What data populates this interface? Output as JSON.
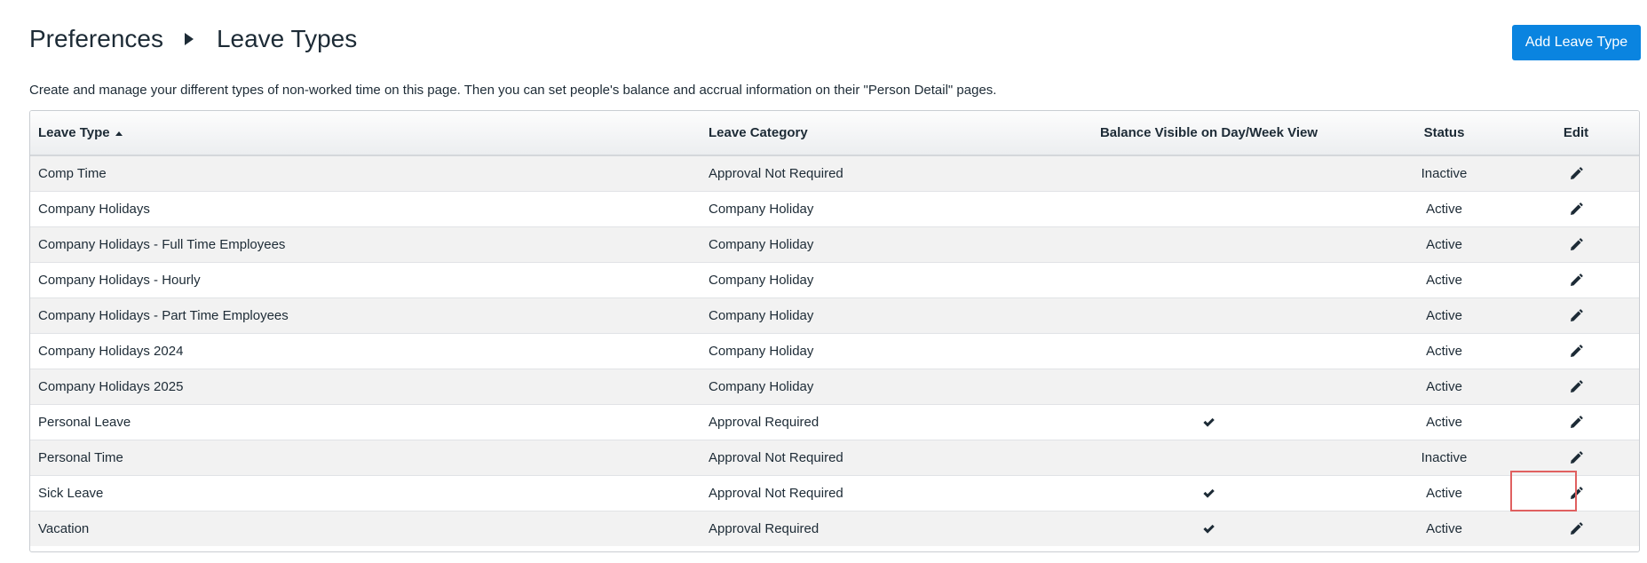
{
  "breadcrumb": {
    "parent": "Preferences",
    "current": "Leave Types"
  },
  "add_button_label": "Add Leave Type",
  "description": "Create and manage your different types of non-worked time on this page. Then you can set people's balance and accrual information on their \"Person Detail\" pages.",
  "colors": {
    "accent": "#0a84e0",
    "highlight": "#e06060"
  },
  "table": {
    "columns": {
      "leave_type": "Leave Type",
      "leave_category": "Leave Category",
      "balance_visible": "Balance Visible on Day/Week View",
      "status": "Status",
      "edit": "Edit"
    },
    "sort": {
      "column": "leave_type",
      "direction": "ascending"
    },
    "rows": [
      {
        "leave_type": "Comp Time",
        "category": "Approval Not Required",
        "balance_visible": false,
        "status": "Inactive"
      },
      {
        "leave_type": "Company Holidays",
        "category": "Company Holiday",
        "balance_visible": false,
        "status": "Active"
      },
      {
        "leave_type": "Company Holidays - Full Time Employees",
        "category": "Company Holiday",
        "balance_visible": false,
        "status": "Active"
      },
      {
        "leave_type": "Company Holidays - Hourly",
        "category": "Company Holiday",
        "balance_visible": false,
        "status": "Active"
      },
      {
        "leave_type": "Company Holidays - Part Time Employees",
        "category": "Company Holiday",
        "balance_visible": false,
        "status": "Active"
      },
      {
        "leave_type": "Company Holidays 2024",
        "category": "Company Holiday",
        "balance_visible": false,
        "status": "Active"
      },
      {
        "leave_type": "Company Holidays 2025",
        "category": "Company Holiday",
        "balance_visible": false,
        "status": "Active"
      },
      {
        "leave_type": "Personal Leave",
        "category": "Approval Required",
        "balance_visible": true,
        "status": "Active"
      },
      {
        "leave_type": "Personal Time",
        "category": "Approval Not Required",
        "balance_visible": false,
        "status": "Inactive"
      },
      {
        "leave_type": "Sick Leave",
        "category": "Approval Not Required",
        "balance_visible": true,
        "status": "Active"
      },
      {
        "leave_type": "Vacation",
        "category": "Approval Required",
        "balance_visible": true,
        "status": "Active"
      }
    ]
  },
  "icons": {
    "edit": "pencil-icon",
    "balance": "checkmark-icon",
    "sort": "sort-up-icon",
    "separator": "triangle-right-icon"
  }
}
